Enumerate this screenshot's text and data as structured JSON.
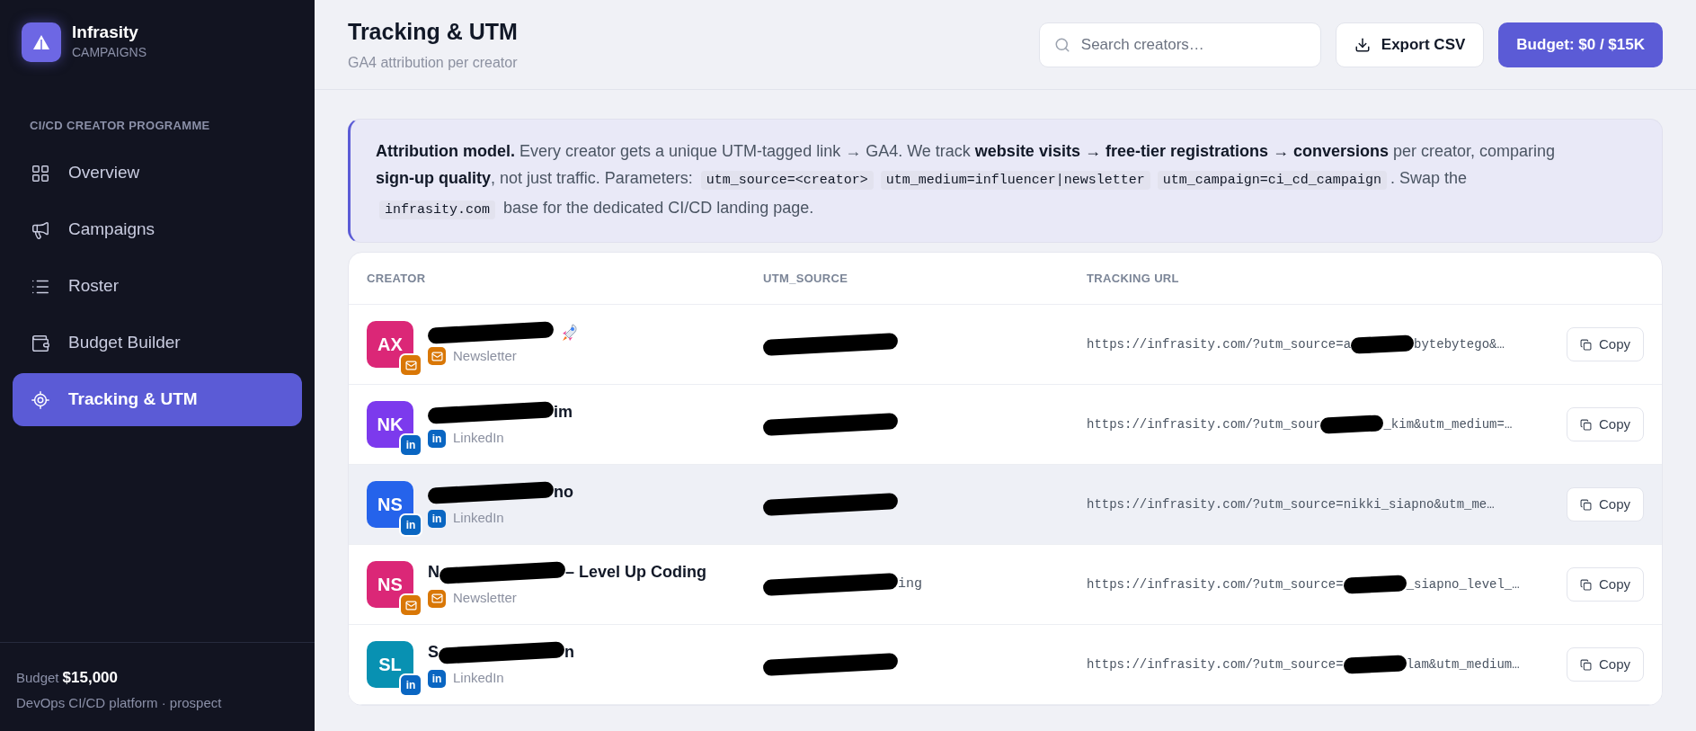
{
  "brand": {
    "name": "Infrasity",
    "subtitle": "CAMPAIGNS"
  },
  "sidebar": {
    "section": "CI/CD CREATOR PROGRAMME",
    "items": [
      {
        "label": "Overview",
        "selected": false
      },
      {
        "label": "Campaigns",
        "selected": false
      },
      {
        "label": "Roster",
        "selected": false
      },
      {
        "label": "Budget Builder",
        "selected": false
      },
      {
        "label": "Tracking & UTM",
        "selected": true
      }
    ],
    "footer": {
      "label": "Budget",
      "amount": "$15,000",
      "note": "DevOps CI/CD platform · prospect"
    }
  },
  "header": {
    "title": "Tracking & UTM",
    "subtitle": "GA4 attribution per creator",
    "search": {
      "placeholder": "Search creators…"
    },
    "export": "Export CSV",
    "budget": "Budget: $0 / $15K"
  },
  "info": [
    {
      "kind": "bold",
      "text": "Attribution model."
    },
    {
      "kind": "text",
      "text": " Every creator gets a unique UTM-tagged link → GA4. We track "
    },
    {
      "kind": "bold",
      "text": "website visits → free-tier registrations → conversions"
    },
    {
      "kind": "text",
      "text": " per creator, comparing "
    },
    {
      "kind": "bold",
      "text": "sign-up quality"
    },
    {
      "kind": "text",
      "text": ", not just traffic. Parameters: "
    },
    {
      "kind": "code",
      "text": "utm_source=<creator>"
    },
    {
      "kind": "code",
      "text": "utm_medium=influencer|newsletter"
    },
    {
      "kind": "code",
      "text": "utm_campaign=ci_cd_campaign"
    },
    {
      "kind": "text",
      "text": ". Swap the "
    },
    {
      "kind": "code",
      "text": "infrasity.com"
    },
    {
      "kind": "text",
      "text": " base for the dedicated CI/CD landing page."
    }
  ],
  "table": {
    "columns": [
      "CREATOR",
      "UTM_SOURCE",
      "TRACKING URL"
    ],
    "rows": [
      {
        "initials": "AX",
        "copy": "Copy",
        "color": "#db2777",
        "channel": {
          "kind": "newsletter",
          "label": "Newsletter"
        },
        "rocket": true,
        "highlighted": false,
        "name": {
          "redacted": true
        },
        "source": {
          "redacted": true
        },
        "url": {
          "before": "https://infrasity.com/?utm_source=a",
          "after": "bytebytego&…",
          "redacted": true
        }
      },
      {
        "initials": "NK",
        "copy": "Copy",
        "color": "#7c3aed",
        "channel": {
          "kind": "linkedin",
          "label": "LinkedIn",
          "avatar_badge": "in",
          "badge": "in"
        },
        "rocket": false,
        "highlighted": false,
        "name": {
          "after": "im",
          "redacted": true
        },
        "source": {
          "redacted": true
        },
        "url": {
          "before": "https://infrasity.com/?utm_sour",
          "after": "_kim&utm_medium=…",
          "redacted": true
        }
      },
      {
        "initials": "NS",
        "copy": "Copy",
        "color": "#2563eb",
        "channel": {
          "kind": "linkedin",
          "label": "LinkedIn",
          "avatar_badge": "in",
          "badge": "in"
        },
        "rocket": false,
        "highlighted": true,
        "name": {
          "after": "no",
          "redacted": true
        },
        "source": {
          "redacted": true
        },
        "url": {
          "before": "https://infrasity.com/?utm_source=nikki_siapno&utm_me…",
          "redacted": false
        }
      },
      {
        "initials": "NS",
        "copy": "Copy",
        "color": "#db2777",
        "channel": {
          "kind": "newsletter",
          "label": "Newsletter"
        },
        "rocket": false,
        "highlighted": false,
        "name": {
          "before": "N",
          "after": "– Level Up Coding",
          "redacted": true
        },
        "source": {
          "after": "ing",
          "redacted": true
        },
        "url": {
          "before": "https://infrasity.com/?utm_source=",
          "after": "_siapno_level_…",
          "redacted": true
        }
      },
      {
        "initials": "SL",
        "copy": "Copy",
        "color": "#0891b2",
        "channel": {
          "kind": "linkedin",
          "label": "LinkedIn",
          "avatar_badge": "in",
          "badge": "in"
        },
        "rocket": false,
        "highlighted": false,
        "name": {
          "before": "S",
          "after": "n",
          "redacted": true
        },
        "source": {
          "redacted": true
        },
        "url": {
          "before": "https://infrasity.com/?utm_source=",
          "after": "lam&utm_medium…",
          "redacted": true
        }
      }
    ]
  }
}
